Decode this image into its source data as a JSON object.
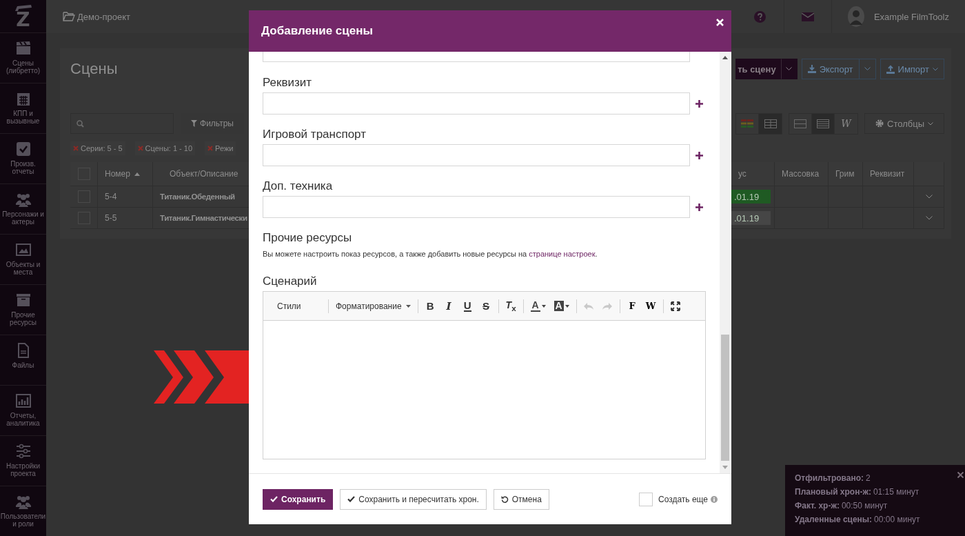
{
  "sidebar": {
    "logo": "Z",
    "items": [
      {
        "label": "Сцены (либретто)"
      },
      {
        "label": "КПП и вызывные"
      },
      {
        "label": "Произв. отчеты"
      },
      {
        "label": "Персонажи и актеры"
      },
      {
        "label": "Объекты и места"
      },
      {
        "label": "Прочие ресурсы"
      },
      {
        "label": "Файлы"
      },
      {
        "label": "Отчеты, аналитика"
      },
      {
        "label": "Настройки проекта"
      },
      {
        "label": "Пользователи и роли"
      }
    ]
  },
  "topbar": {
    "breadcrumb": "Демо-проект",
    "user": "Example FilmToolz"
  },
  "page": {
    "title": "Сцены",
    "actions": [
      {
        "kind": "primary",
        "label": "ть сцену",
        "split": true
      },
      {
        "kind": "outline",
        "label": "Экспорт",
        "split": true
      },
      {
        "kind": "outline",
        "label": "Импорт",
        "split": false
      }
    ]
  },
  "filters": {
    "button": "Фильтры",
    "chips": [
      "Серии: 5 - 5",
      "Сцены: 1 - 10",
      "Режи"
    ],
    "view_toggles": [
      [
        {
          "kind": "icon",
          "selected": false
        },
        {
          "kind": "icon",
          "selected": true
        }
      ],
      [
        {
          "kind": "icon",
          "selected": false
        },
        {
          "kind": "icon",
          "selected": true
        },
        {
          "kind": "glyph",
          "label": "W",
          "selected": false
        }
      ]
    ],
    "columns_button": "Столбцы"
  },
  "table": {
    "select_all": false,
    "columns": [
      "Номер",
      "Объект/Описание",
      "ус",
      "Массовка",
      "Грим",
      "Реквизит"
    ],
    "rows": [
      {
        "checked": false,
        "number": "5-4",
        "object": "Титаник.Обеденный",
        "status": ".01.19",
        "color": "#1f5a23"
      },
      {
        "checked": false,
        "number": "5-5",
        "object": "Титаник.Гимнастически",
        "status": ".01.19",
        "color": "#464646"
      }
    ]
  },
  "summary": {
    "rows": [
      {
        "label": "Отфильтровано:",
        "value": "2"
      },
      {
        "label": "Плановый хрон-ж:",
        "value": "01:15 минут"
      },
      {
        "label": "Факт. хр-ж:",
        "value": "00:50 минут"
      },
      {
        "label": "Удаленные сцены:",
        "value": "00:00 минут"
      }
    ]
  },
  "modal": {
    "title": "Добавление сцены",
    "fields": [
      {
        "kind": "partial"
      },
      {
        "kind": "full",
        "label": "Реквизит"
      },
      {
        "kind": "full",
        "label": "Игровой транспорт"
      },
      {
        "kind": "full",
        "label": "Доп. техника"
      }
    ],
    "other": {
      "heading": "Прочие ресурсы",
      "text": "Вы можете настроить показ ресурсов, а также добавить новые ресурсы на ",
      "link": "странице настроек",
      "after": "."
    },
    "script": {
      "label": "Сценарий",
      "toolbar": [
        [
          {
            "kind": "combo",
            "label": "Стили",
            "disabled": false
          }
        ],
        [
          {
            "kind": "combo",
            "label": "Форматирование",
            "disabled": false
          }
        ],
        [
          {
            "kind": "glyph",
            "label": "B",
            "disabled": false
          },
          {
            "kind": "glyph",
            "label": "I",
            "disabled": false
          },
          {
            "kind": "glyph",
            "label": "U",
            "disabled": false
          },
          {
            "kind": "glyph",
            "label": "S",
            "disabled": false
          }
        ],
        [
          {
            "kind": "glyph",
            "label": "*T*$_{x}$",
            "disabled": false
          }
        ],
        [
          {
            "kind": "color",
            "label": "A",
            "disabled": false
          },
          {
            "kind": "color",
            "label": "A",
            "disabled": false
          }
        ],
        [
          {
            "kind": "icon",
            "disabled": true
          },
          {
            "kind": "icon",
            "disabled": true
          }
        ],
        [
          {
            "kind": "glyph",
            "label": "F",
            "disabled": false
          },
          {
            "kind": "glyph",
            "label": "W",
            "disabled": false
          }
        ],
        [
          {
            "kind": "icon",
            "disabled": false
          }
        ]
      ]
    },
    "footer": {
      "buttons": [
        {
          "kind": "primary",
          "label": "Сохранить"
        },
        {
          "kind": "default",
          "label": "Сохранить и пересчитать хрон."
        },
        {
          "kind": "default",
          "label": "Отмена"
        }
      ],
      "create_more": {
        "label": "Создать еще",
        "checked": false
      }
    }
  }
}
